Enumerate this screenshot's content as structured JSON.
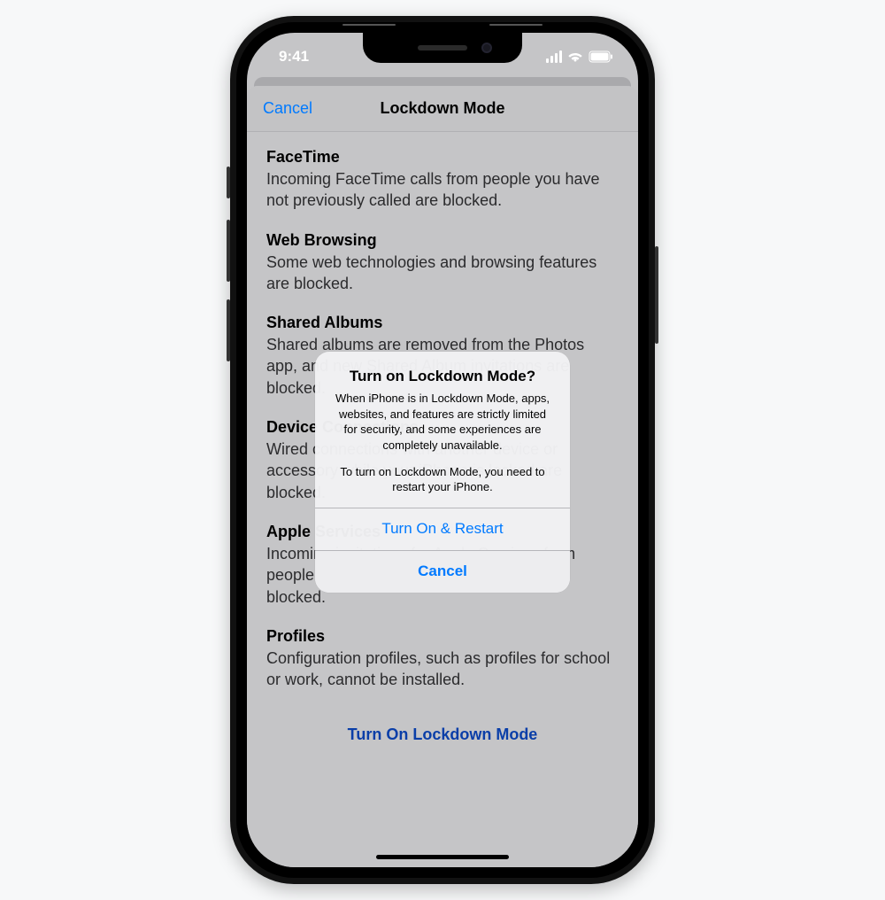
{
  "status_bar": {
    "time": "9:41"
  },
  "nav": {
    "cancel_label": "Cancel",
    "title": "Lockdown Mode"
  },
  "sections": [
    {
      "title": "FaceTime",
      "body": "Incoming FaceTime calls from people you have not previously called are blocked."
    },
    {
      "title": "Web Browsing",
      "body": "Some web technologies and browsing features are blocked."
    },
    {
      "title": "Shared Albums",
      "body": "Shared albums are removed from the Photos app, and new Shared Album invitations are blocked."
    },
    {
      "title": "Device Connections",
      "body": "Wired connections with another device or accessory while your iPhone is locked are blocked."
    },
    {
      "title": "Apple Services",
      "body": "Incoming invitations for Apple Services from people you have not previously invited are blocked."
    },
    {
      "title": "Profiles",
      "body": "Configuration profiles, such as profiles for school or work, cannot be installed."
    }
  ],
  "bottom_action": "Turn On Lockdown Mode",
  "alert": {
    "title": "Turn on Lockdown Mode?",
    "message1": "When iPhone is in Lockdown Mode, apps, websites, and features are strictly limited for security, and some experiences are completely unavailable.",
    "message2": "To turn on Lockdown Mode, you need to restart your iPhone.",
    "confirm": "Turn On & Restart",
    "cancel": "Cancel"
  }
}
